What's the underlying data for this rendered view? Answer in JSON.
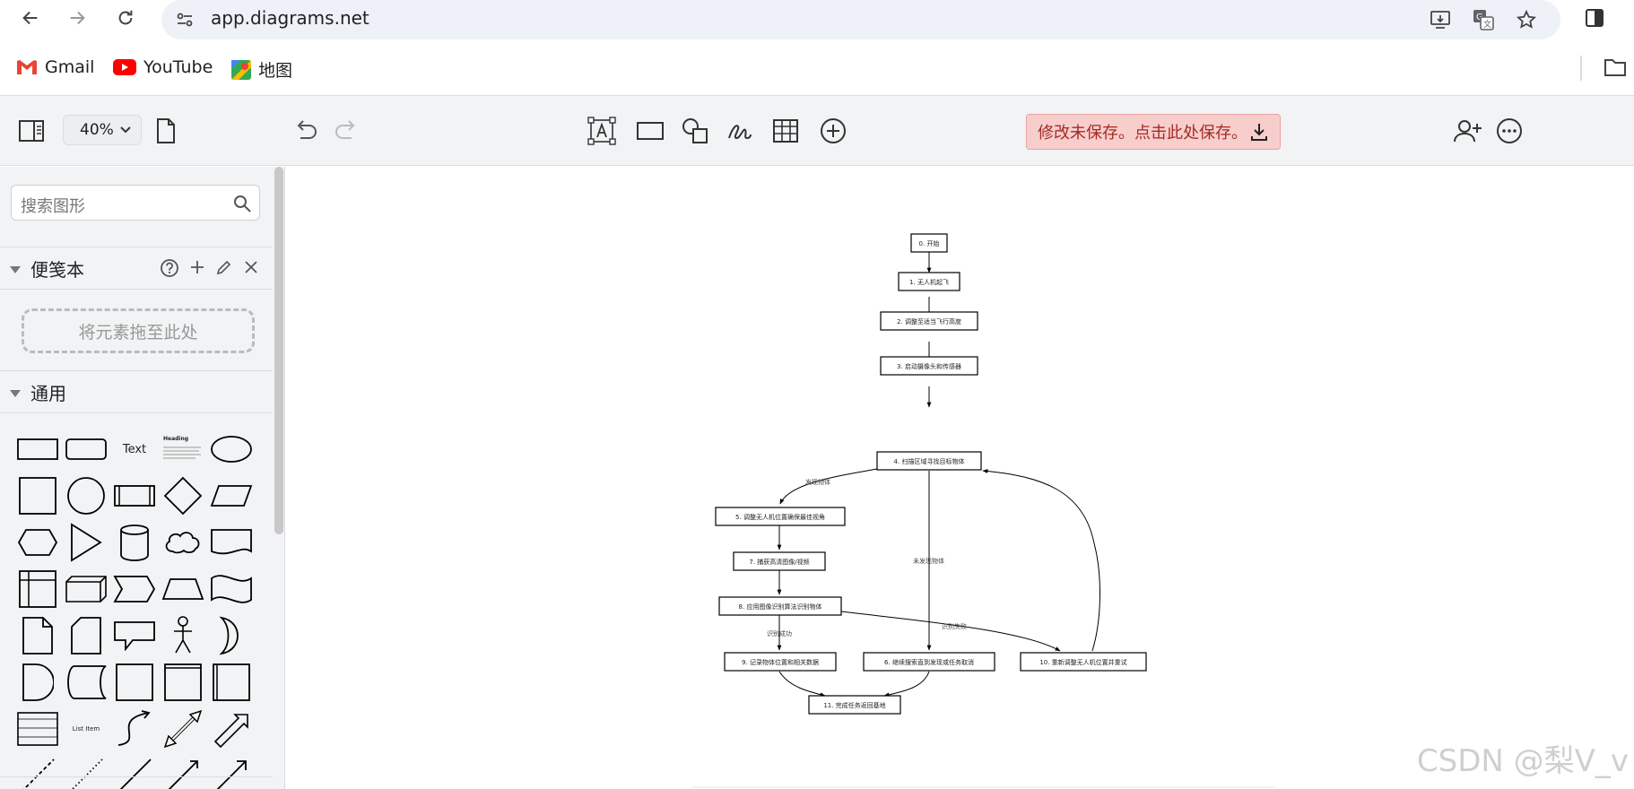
{
  "browser": {
    "url": "app.diagrams.net"
  },
  "bookmarks": [
    {
      "label": "Gmail"
    },
    {
      "label": "YouTube"
    },
    {
      "label": "地图"
    }
  ],
  "toolbar": {
    "zoom": "40%",
    "save_banner": "修改未保存。点击此处保存。"
  },
  "sidebar": {
    "search_placeholder": "搜索图形",
    "scratchpad_title": "便笺本",
    "drop_zone": "将元素拖至此处",
    "general_title": "通用",
    "shape_text": "Text",
    "shape_heading": "Heading",
    "shape_list_item": "List Item"
  },
  "flowchart": {
    "nodes": [
      {
        "id": "n0",
        "label": "0. 开始"
      },
      {
        "id": "n1",
        "label": "1. 无人机起飞"
      },
      {
        "id": "n2",
        "label": "2. 调整至适当飞行高度"
      },
      {
        "id": "n3",
        "label": "3. 启动摄像头和传感器"
      },
      {
        "id": "n4",
        "label": "4. 扫描区域寻找目标物体"
      },
      {
        "id": "n5",
        "label": "5. 调整无人机位置确保最佳视角"
      },
      {
        "id": "n7",
        "label": "7. 捕获高清图像/视频"
      },
      {
        "id": "n8",
        "label": "8. 应用图像识别算法识别物体"
      },
      {
        "id": "n9",
        "label": "9. 记录物体位置和相关数据"
      },
      {
        "id": "n6",
        "label": "6. 继续搜索直到发现或任务取消"
      },
      {
        "id": "n10",
        "label": "10. 重新调整无人机位置并重试"
      },
      {
        "id": "n11",
        "label": "11. 完成任务返回基地"
      }
    ],
    "edge_labels": {
      "found": "发现物体",
      "not_found": "未发现物体",
      "success": "识别成功",
      "fail": "识别失败"
    }
  },
  "watermark": "CSDN @梨V_v"
}
